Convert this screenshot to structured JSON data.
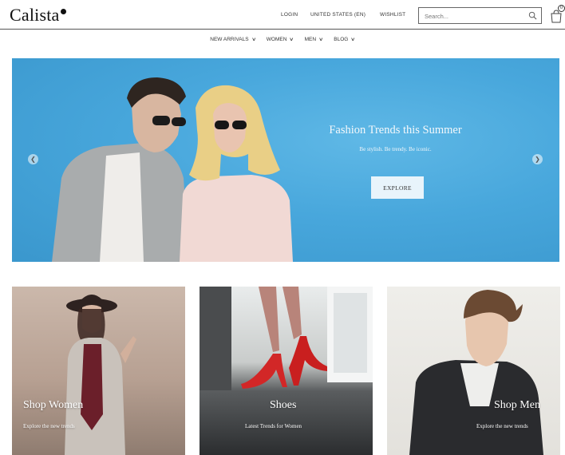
{
  "header": {
    "logo": "Calista",
    "links": {
      "login": "LOGIN",
      "region": "UNITED STATES (EN)",
      "wishlist": "WISHLIST"
    },
    "search": {
      "placeholder": "Search...",
      "icon": "search-icon"
    },
    "cart": {
      "icon": "shopping-bag-icon",
      "count": "0"
    }
  },
  "nav": {
    "items": [
      {
        "label": "NEW ARRIVALS"
      },
      {
        "label": "WOMEN"
      },
      {
        "label": "MEN"
      },
      {
        "label": "BLOG"
      }
    ]
  },
  "hero": {
    "title": "Fashion Trends this Summer",
    "subtitle": "Be stylish. Be trendy. Be iconic.",
    "button": "EXPLORE",
    "prev_icon": "arrow-left-icon",
    "next_icon": "arrow-right-icon",
    "background_color": "#48a7dc"
  },
  "tiles": [
    {
      "title": "Shop Women",
      "subtitle": "Explore the new trends"
    },
    {
      "title": "Shoes",
      "subtitle": "Latest Trends for Women"
    },
    {
      "title": "Shop Men",
      "subtitle": "Explore the new trends"
    }
  ]
}
